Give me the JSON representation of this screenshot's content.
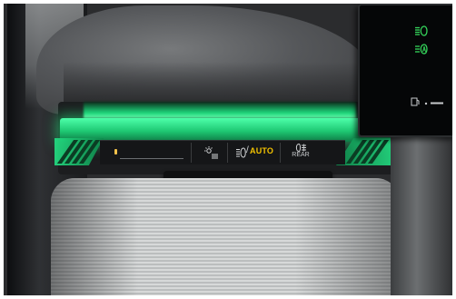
{
  "image": {
    "description_type": "photo"
  },
  "light_panel": {
    "auto_label": "AUTO",
    "rear_label": "REAR",
    "accent_green": "#22e07f",
    "accent_amber": "#f2c200"
  },
  "cluster_screen": {
    "icons": [
      "headlight-indicator-icon",
      "auto-headlight-indicator-icon",
      "fuel-pump-icon"
    ]
  }
}
